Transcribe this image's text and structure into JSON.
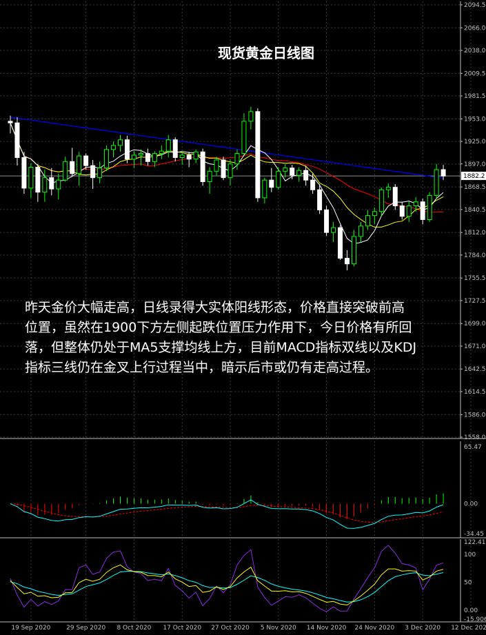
{
  "title": "现货黄金日线图",
  "commentary": "昨天金价大幅走高，日线录得大实体阳线形态，价格直接突破前高\n位置，虽然在1900下方左侧起跌位置压力作用下，今日价格有所回\n落，但整体仍处于MA5支撑均线上方，目前MACD指标双线以及KDJ\n指标三线仍在金叉上行过程当中，暗示后市或仍有走高过程。",
  "colors": {
    "background": "#000000",
    "grid": "#3a3a3a",
    "axis": "#bfbfbf",
    "bull_candle": "#ffffff",
    "bear_candle": "#00ff00",
    "ma5": "#ffffff",
    "ma10": "#ffff00",
    "ma20": "#ff0000",
    "ma60": "#0000ff",
    "macd_pos": "#00ff00",
    "macd_neg": "#ff0000",
    "dif": "#00ffff",
    "dea": "#ff0000",
    "k": "#ffff00",
    "d": "#00ffff",
    "j": "#8a2be2",
    "current_price_line": "#bfbfbf"
  },
  "chart_data": [
    {
      "type": "candlestick",
      "name_panel": "price",
      "y_ticks": [
        "2094.5",
        "2066.0",
        "2038.0",
        "2009.5",
        "1981.5",
        "1953.0",
        "1925.0",
        "1897.0",
        "1868.5",
        "1840.5",
        "1812.0",
        "1784.0",
        "1755.5",
        "1727.5",
        "1699.0",
        "1671.0",
        "1642.5",
        "1614.5",
        "1586.0",
        "1558.0"
      ],
      "ylim": [
        1558.0,
        2094.5
      ],
      "current_price": 1882.2,
      "current_price_label": "1882.2",
      "x_ticks": [
        "19 Sep 2020",
        "29 Sep 2020",
        "8 Oct 2020",
        "17 Oct 2020",
        "27 Oct 2020",
        "5 Nov 2020",
        "14 Nov 2020",
        "24 Nov 2020",
        "3 Dec 2020",
        "12 Dec 2020"
      ],
      "x_tick_index": [
        3,
        11,
        18,
        25,
        32,
        39,
        46,
        53,
        60,
        67
      ],
      "ohlc": [
        [
          1950,
          1957,
          1935,
          1948
        ],
        [
          1948,
          1955,
          1895,
          1905
        ],
        [
          1905,
          1912,
          1860,
          1867
        ],
        [
          1867,
          1898,
          1855,
          1893
        ],
        [
          1893,
          1897,
          1850,
          1862
        ],
        [
          1862,
          1890,
          1850,
          1880
        ],
        [
          1880,
          1892,
          1858,
          1866
        ],
        [
          1866,
          1885,
          1853,
          1877
        ],
        [
          1877,
          1906,
          1875,
          1900
        ],
        [
          1900,
          1917,
          1882,
          1885
        ],
        [
          1885,
          1912,
          1870,
          1907
        ],
        [
          1907,
          1910,
          1890,
          1895
        ],
        [
          1895,
          1902,
          1866,
          1880
        ],
        [
          1880,
          1900,
          1873,
          1892
        ],
        [
          1892,
          1920,
          1888,
          1915
        ],
        [
          1915,
          1925,
          1905,
          1920
        ],
        [
          1920,
          1933,
          1912,
          1927
        ],
        [
          1927,
          1932,
          1898,
          1903
        ],
        [
          1903,
          1913,
          1892,
          1908
        ],
        [
          1908,
          1915,
          1895,
          1910
        ],
        [
          1910,
          1916,
          1895,
          1900
        ],
        [
          1900,
          1913,
          1893,
          1910
        ],
        [
          1910,
          1920,
          1903,
          1913
        ],
        [
          1913,
          1933,
          1905,
          1927
        ],
        [
          1927,
          1930,
          1900,
          1905
        ],
        [
          1905,
          1913,
          1896,
          1908
        ],
        [
          1908,
          1912,
          1893,
          1903
        ],
        [
          1903,
          1915,
          1898,
          1912
        ],
        [
          1912,
          1916,
          1870,
          1875
        ],
        [
          1875,
          1893,
          1860,
          1888
        ],
        [
          1888,
          1906,
          1882,
          1902
        ],
        [
          1902,
          1906,
          1877,
          1880
        ],
        [
          1880,
          1903,
          1870,
          1897
        ],
        [
          1897,
          1915,
          1890,
          1910
        ],
        [
          1910,
          1960,
          1908,
          1950
        ],
        [
          1950,
          1968,
          1940,
          1962
        ],
        [
          1962,
          1966,
          1850,
          1855
        ],
        [
          1855,
          1880,
          1848,
          1877
        ],
        [
          1877,
          1892,
          1862,
          1868
        ],
        [
          1868,
          1893,
          1865,
          1888
        ],
        [
          1888,
          1897,
          1880,
          1892
        ],
        [
          1892,
          1896,
          1878,
          1883
        ],
        [
          1883,
          1893,
          1875,
          1889
        ],
        [
          1889,
          1895,
          1870,
          1877
        ],
        [
          1877,
          1885,
          1860,
          1865
        ],
        [
          1865,
          1872,
          1835,
          1840
        ],
        [
          1840,
          1845,
          1808,
          1812
        ],
        [
          1812,
          1825,
          1800,
          1818
        ],
        [
          1818,
          1821,
          1778,
          1780
        ],
        [
          1780,
          1790,
          1765,
          1773
        ],
        [
          1773,
          1815,
          1770,
          1807
        ],
        [
          1807,
          1825,
          1800,
          1820
        ],
        [
          1820,
          1840,
          1815,
          1833
        ],
        [
          1833,
          1843,
          1822,
          1838
        ],
        [
          1838,
          1868,
          1832,
          1865
        ],
        [
          1865,
          1873,
          1855,
          1868
        ],
        [
          1868,
          1872,
          1840,
          1845
        ],
        [
          1845,
          1850,
          1828,
          1832
        ],
        [
          1832,
          1850,
          1825,
          1845
        ],
        [
          1845,
          1856,
          1838,
          1850
        ],
        [
          1850,
          1854,
          1822,
          1828
        ],
        [
          1828,
          1862,
          1825,
          1858
        ],
        [
          1858,
          1897,
          1855,
          1890
        ],
        [
          1890,
          1896,
          1877,
          1882
        ]
      ]
    },
    {
      "type": "macd",
      "name_panel": "macd",
      "y_ticks": [
        "65.47",
        "0.00",
        "-34.45"
      ],
      "ylim": [
        -34.45,
        65.47
      ]
    },
    {
      "type": "kdj",
      "name_panel": "kdj",
      "y_ticks": [
        "122.415",
        "100",
        "50",
        "0.00",
        "-15.9062"
      ],
      "ylim": [
        -15.9062,
        122.415
      ]
    }
  ]
}
